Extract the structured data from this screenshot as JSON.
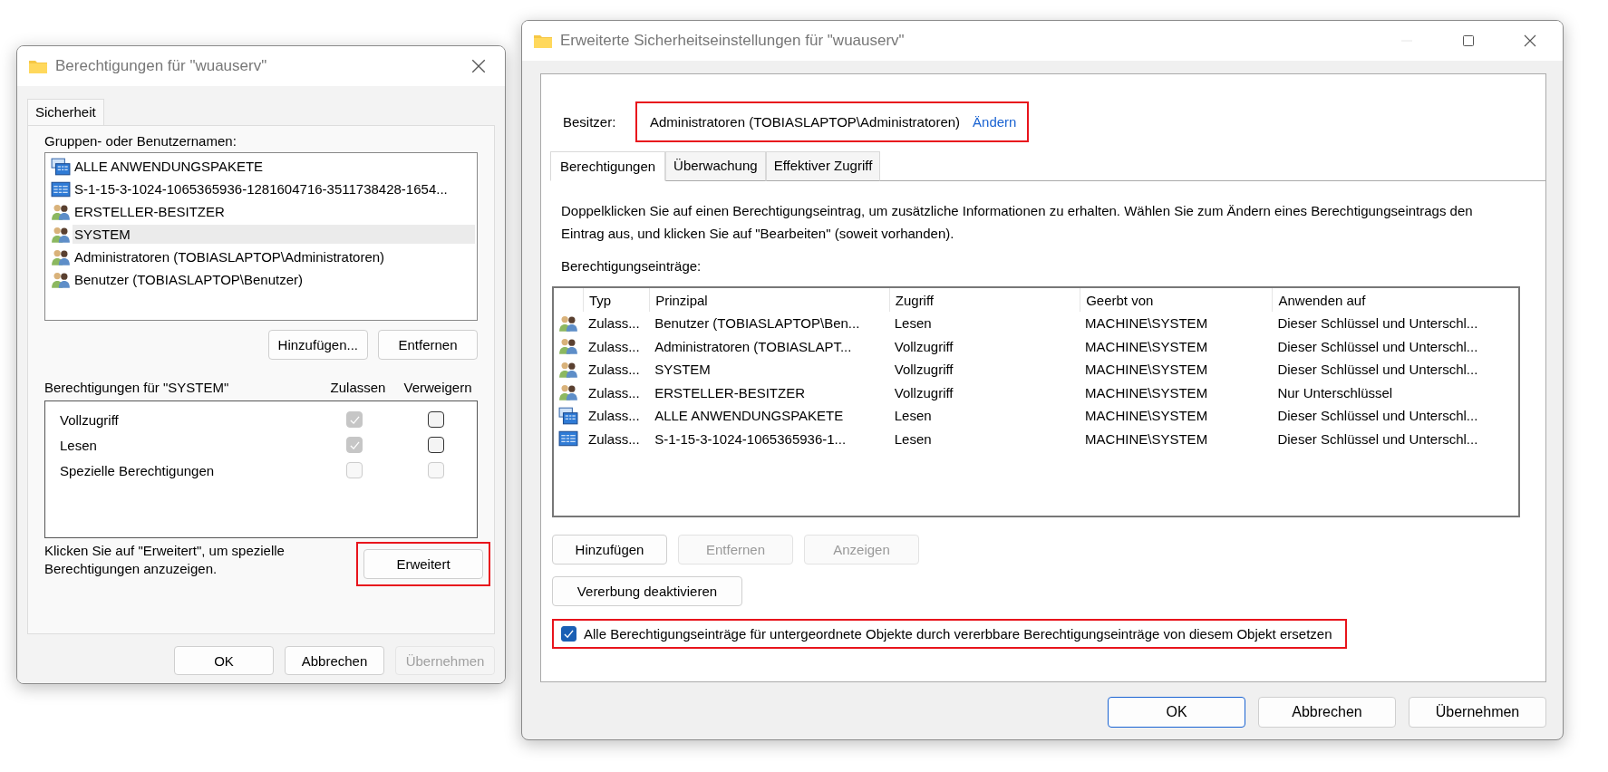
{
  "permissions_dialog": {
    "title": "Berechtigungen für \"wuauserv\"",
    "tabs": [
      {
        "label": "Sicherheit",
        "selected": true
      }
    ],
    "groups_label": "Gruppen- oder Benutzernamen:",
    "principals": [
      {
        "name": "ALLE ANWENDUNGSPAKETE",
        "kind": "package",
        "selected": false
      },
      {
        "name": "S-1-15-3-1024-1065365936-1281604716-3511738428-1654...",
        "kind": "capability",
        "selected": false
      },
      {
        "name": "ERSTELLER-BESITZER",
        "kind": "user",
        "selected": false
      },
      {
        "name": "SYSTEM",
        "kind": "user",
        "selected": true
      },
      {
        "name": "Administratoren (TOBIASLAPTOP\\Administratoren)",
        "kind": "user",
        "selected": false
      },
      {
        "name": "Benutzer (TOBIASLAPTOP\\Benutzer)",
        "kind": "user",
        "selected": false
      }
    ],
    "list_buttons": [
      {
        "label": "Hinzufügen..."
      },
      {
        "label": "Entfernen"
      }
    ],
    "permissions_label": "Berechtigungen für \"SYSTEM\"",
    "columns": [
      "Zulassen",
      "Verweigern"
    ],
    "permissions": [
      {
        "name": "Vollzugriff",
        "allow": {
          "checked": true,
          "disabled": true
        },
        "deny": {
          "checked": false,
          "disabled": false
        }
      },
      {
        "name": "Lesen",
        "allow": {
          "checked": true,
          "disabled": true
        },
        "deny": {
          "checked": false,
          "disabled": false
        }
      },
      {
        "name": "Spezielle Berechtigungen",
        "allow": {
          "checked": false,
          "disabled": true
        },
        "deny": {
          "checked": false,
          "disabled": true
        }
      }
    ],
    "hint": "Klicken Sie auf \"Erweitert\", um spezielle Berechtigungen anzuzeigen.",
    "advanced_button": {
      "label": "Erweitert",
      "highlighted": true
    },
    "footer_buttons": [
      {
        "label": "OK",
        "disabled": false
      },
      {
        "label": "Abbrechen",
        "disabled": false
      },
      {
        "label": "Übernehmen",
        "disabled": true
      }
    ]
  },
  "advanced_dialog": {
    "title": "Erweiterte Sicherheitseinstellungen für \"wuauserv\"",
    "owner": {
      "label": "Besitzer:",
      "value": "Administratoren (TOBIASLAPTOP\\Administratoren)",
      "link": "Ändern",
      "highlighted": true
    },
    "tabs": [
      {
        "label": "Berechtigungen",
        "selected": true
      },
      {
        "label": "Überwachung",
        "selected": false
      },
      {
        "label": "Effektiver Zugriff",
        "selected": false
      }
    ],
    "description": "Doppelklicken Sie auf einen Berechtigungseintrag, um zusätzliche Informationen zu erhalten. Wählen Sie zum Ändern eines Berechtigungseintrags den Eintrag aus, und klicken Sie auf \"Bearbeiten\" (soweit vorhanden).",
    "entries_label": "Berechtigungseinträge:",
    "table": {
      "columns": [
        "Typ",
        "Prinzipal",
        "Zugriff",
        "Geerbt von",
        "Anwenden auf"
      ],
      "rows": [
        {
          "kind": "user",
          "cells": [
            "Zulass...",
            "Benutzer (TOBIASLAPTOP\\Ben...",
            "Lesen",
            "MACHINE\\SYSTEM",
            "Dieser Schlüssel und Unterschl..."
          ]
        },
        {
          "kind": "user",
          "cells": [
            "Zulass...",
            "Administratoren (TOBIASLAPT...",
            "Vollzugriff",
            "MACHINE\\SYSTEM",
            "Dieser Schlüssel und Unterschl..."
          ]
        },
        {
          "kind": "user",
          "cells": [
            "Zulass...",
            "SYSTEM",
            "Vollzugriff",
            "MACHINE\\SYSTEM",
            "Dieser Schlüssel und Unterschl..."
          ]
        },
        {
          "kind": "user",
          "cells": [
            "Zulass...",
            "ERSTELLER-BESITZER",
            "Vollzugriff",
            "MACHINE\\SYSTEM",
            "Nur Unterschlüssel"
          ]
        },
        {
          "kind": "package",
          "cells": [
            "Zulass...",
            "ALLE ANWENDUNGSPAKETE",
            "Lesen",
            "MACHINE\\SYSTEM",
            "Dieser Schlüssel und Unterschl..."
          ]
        },
        {
          "kind": "capability",
          "cells": [
            "Zulass...",
            "S-1-15-3-1024-1065365936-1...",
            "Lesen",
            "MACHINE\\SYSTEM",
            "Dieser Schlüssel und Unterschl..."
          ]
        }
      ]
    },
    "entry_buttons": [
      {
        "label": "Hinzufügen",
        "disabled": false
      },
      {
        "label": "Entfernen",
        "disabled": true
      },
      {
        "label": "Anzeigen",
        "disabled": true
      }
    ],
    "inheritance_button": {
      "label": "Vererbung deaktivieren"
    },
    "replace_option": {
      "label": "Alle Berechtigungseinträge für untergeordnete Objekte durch vererbbare Berechtigungseinträge von diesem Objekt ersetzen",
      "checked": true,
      "highlighted": true
    },
    "footer_buttons": [
      {
        "label": "OK",
        "default": true
      },
      {
        "label": "Abbrechen",
        "default": false
      },
      {
        "label": "Übernehmen",
        "default": false
      }
    ]
  }
}
